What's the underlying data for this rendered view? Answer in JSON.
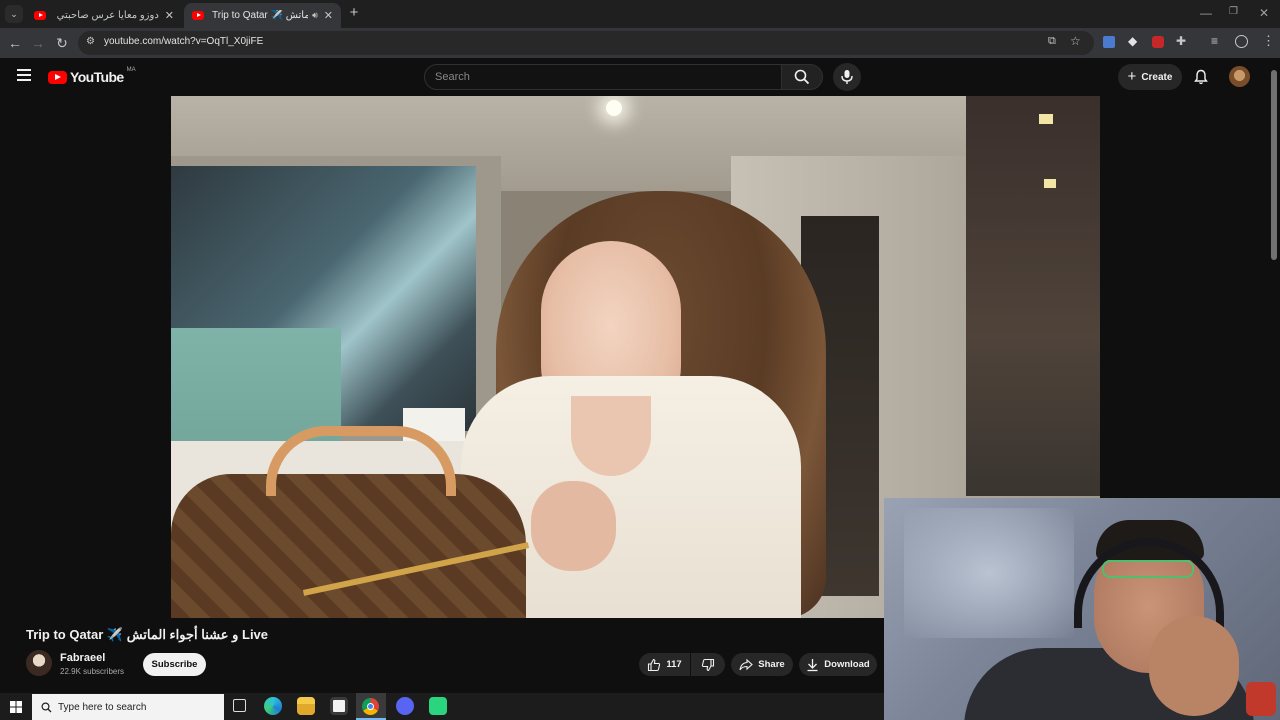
{
  "browser": {
    "tabs": [
      {
        "title": "دوزو معايا عرس صاحبتي🌷🎗️حب",
        "active": false
      },
      {
        "title": "Trip to Qatar ✈️ و عشنا أجواء الماتش",
        "active": true
      }
    ],
    "new_tab_symbol": "+",
    "url": "youtube.com/watch?v=OqTl_X0jiFE"
  },
  "youtube": {
    "logo_text": "YouTube",
    "country_code": "MA",
    "search_placeholder": "Search",
    "create_label": "Create",
    "video": {
      "title": "Trip to Qatar ✈️ و عشنا أجواء الماتش Live",
      "channel": "Fabraeel",
      "subscribers": "22.9K subscribers",
      "subscribe_label": "Subscribe",
      "like_count": "117",
      "share_label": "Share",
      "download_label": "Download"
    }
  },
  "taskbar": {
    "search_placeholder": "Type here to search"
  },
  "colors": {
    "youtube_red": "#ff0000",
    "page_bg": "#0f0f0f",
    "chrome_toolbar": "#35363a"
  }
}
